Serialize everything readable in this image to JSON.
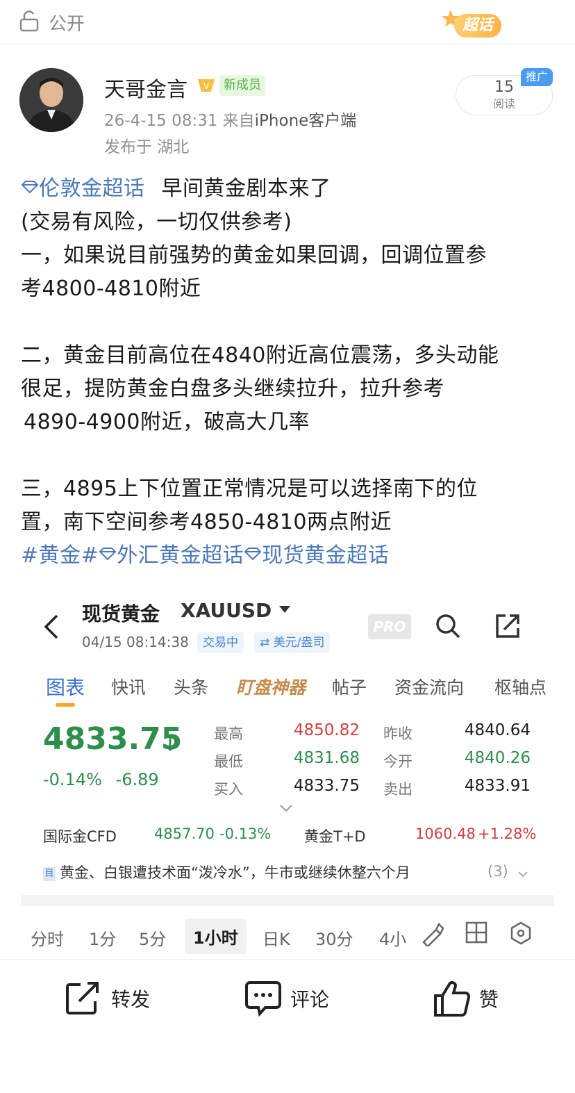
{
  "topbar": {
    "visibility": "公开",
    "supertopic_badge": "超话"
  },
  "author": {
    "name": "天哥金言",
    "new_member_badge": "新成员",
    "time": "26-4-15 08:31",
    "from_prefix": "来自",
    "client": "iPhone客户端",
    "location": "发布于 湖北"
  },
  "reads": {
    "count": "15",
    "label": "阅读",
    "promo": "推广"
  },
  "post": {
    "topic": "伦敦金超话",
    "headline": "早间黄金剧本来了",
    "lines": [
      "(交易有风险，一切仅供参考)",
      "一，如果说目前强势的黄金如果回调，回调位置参",
      "考4800-4810附近",
      "二，黄金目前高位在4840附近高位震荡，多头动能",
      "很足，提防黄金白盘多头继续拉升，拉升参考",
      "4890-4900附近，破高大几率",
      "三，4895上下位置正常情况是可以选择南下的位",
      "置，南下空间参考4850-4810两点附近"
    ],
    "tags": {
      "gold": "#黄金#",
      "forex": "外汇黄金超话",
      "spot": "现货黄金超话"
    }
  },
  "trade": {
    "title": "现货黄金",
    "symbol": "XAUUSD",
    "datetime": "04/15 08:14:38",
    "status": "交易中",
    "currency": "⇄ 美元/盎司",
    "pro": "PRO",
    "tabs": [
      "图表",
      "快讯",
      "头条",
      "盯盘神器",
      "帖子",
      "资金流向",
      "枢轴点"
    ],
    "price": "4833.75",
    "change_pct": "-0.14%",
    "change_abs": "-6.89",
    "quote": {
      "high_label": "最高",
      "high": "4850.82",
      "low_label": "最低",
      "low": "4831.68",
      "bid_label": "买入",
      "bid": "4833.75",
      "prev_close_label": "昨收",
      "prev_close": "4840.64",
      "open_label": "今开",
      "open": "4840.26",
      "ask_label": "卖出",
      "ask": "4833.91"
    },
    "cfd": {
      "label": "国际金CFD",
      "price": "4857.70",
      "chg": "-0.13%"
    },
    "td": {
      "label": "黄金T+D",
      "price": "1060.48",
      "chg": "+1.28%"
    },
    "news": {
      "icon": "目",
      "text": "黄金、白银遭技术面“泼冷水”，牛市或继续休整六个月",
      "count": "(3)"
    },
    "periods": [
      "分时",
      "1分",
      "5分",
      "1小时",
      "日K",
      "30分",
      "4小"
    ]
  },
  "actions": {
    "repost": "转发",
    "comment": "评论",
    "like": "赞"
  },
  "colors": {
    "link": "#4a78b8",
    "up": "#d23f3f",
    "down": "#2e8f4c",
    "tab_active": "#3a6fd8",
    "accent": "#f5a623"
  }
}
